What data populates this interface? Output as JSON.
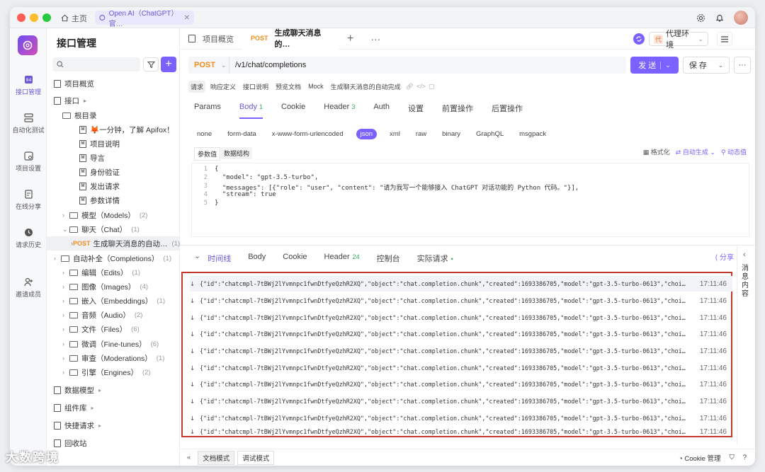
{
  "titlebar": {
    "home_label": "主页",
    "tab_label": "Open AI（ChatGPT）官…"
  },
  "rail": {
    "items": [
      {
        "label": "接口管理"
      },
      {
        "label": "自动化测试"
      },
      {
        "label": "项目设置"
      },
      {
        "label": "在线分享"
      },
      {
        "label": "请求历史"
      },
      {
        "label": "邀请成员"
      }
    ]
  },
  "sidebar": {
    "title": "接口管理",
    "overview": "项目概览",
    "api_root": "接口",
    "root_dir": "根目录",
    "docs": [
      "🦊一分钟，了解 Apifox！",
      "项目说明",
      "导言",
      "身份验证",
      "发出请求",
      "参数详情"
    ],
    "folders": [
      {
        "label": "模型（Models）",
        "count": "(2)"
      },
      {
        "label": "聊天（Chat）",
        "count": "(1)"
      },
      {
        "label": "自动补全（Completions）",
        "count": "(1)"
      },
      {
        "label": "编辑（Edits）",
        "count": "(1)"
      },
      {
        "label": "图像（Images）",
        "count": "(4)"
      },
      {
        "label": "嵌入（Embeddings）",
        "count": "(1)"
      },
      {
        "label": "音频（Audio）",
        "count": "(2)"
      },
      {
        "label": "文件（Files）",
        "count": "(6)"
      },
      {
        "label": "微调（Fine-tunes）",
        "count": "(6)"
      },
      {
        "label": "审查（Moderations）",
        "count": "(1)"
      },
      {
        "label": "引擎（Engines）",
        "count": "(2)"
      }
    ],
    "selected_request": {
      "method": "POST",
      "label": "生成聊天消息的自动…",
      "count": "(1)"
    },
    "bottom": [
      "数据模型",
      "组件库",
      "快捷请求",
      "回收站"
    ]
  },
  "doc_tabs": {
    "overview": "项目概览",
    "active_method": "POST",
    "active_label": "生成聊天消息的…",
    "env_badge": "代",
    "env_label": "代理环境"
  },
  "request": {
    "method": "POST",
    "path": "/v1/chat/completions",
    "send_label": "发 送",
    "save_label": "保 存"
  },
  "subtabs": [
    "请求",
    "响应定义",
    "接口说明",
    "预览文档",
    "Mock",
    "生成聊天消息的自动完成"
  ],
  "param_tabs": [
    {
      "label": "Params",
      "badge": ""
    },
    {
      "label": "Body",
      "badge": "1"
    },
    {
      "label": "Cookie",
      "badge": ""
    },
    {
      "label": "Header",
      "badge": "3"
    },
    {
      "label": "Auth",
      "badge": ""
    },
    {
      "label": "设置",
      "badge": ""
    },
    {
      "label": "前置操作",
      "badge": ""
    },
    {
      "label": "后置操作",
      "badge": ""
    }
  ],
  "body_types": [
    "none",
    "form-data",
    "x-www-form-urlencoded",
    "json",
    "xml",
    "raw",
    "binary",
    "GraphQL",
    "msgpack"
  ],
  "editor": {
    "tab_param": "参数值",
    "tab_struct": "数据结构",
    "format": "格式化",
    "auto_gen": "自动生成",
    "dynamic": "动态值",
    "lines": [
      {
        "n": "1",
        "text": "{"
      },
      {
        "n": "2",
        "text": "  \"model\": \"gpt-3.5-turbo\","
      },
      {
        "n": "3",
        "text": "  \"messages\": [{\"role\": \"user\", \"content\": \"请为我写一个能够接入 ChatGPT 对话功能的 Python 代码。\"}],"
      },
      {
        "n": "4",
        "text": "  \"stream\": true"
      },
      {
        "n": "5",
        "text": "}"
      }
    ]
  },
  "response": {
    "tabs": [
      {
        "label": "时间线",
        "badge": ""
      },
      {
        "label": "Body",
        "badge": ""
      },
      {
        "label": "Cookie",
        "badge": ""
      },
      {
        "label": "Header",
        "badge": "24"
      },
      {
        "label": "控制台",
        "badge": ""
      },
      {
        "label": "实际请求",
        "badge": "•"
      }
    ],
    "share": "分享",
    "side_label": "消息内容",
    "events": [
      {
        "text": "{\"id\":\"chatcmpl-7tBWj2lYvmnpc1fwnDtfyeQzhR2XQ\",\"object\":\"chat.completion.chunk\",\"created\":1693386705,\"model\":\"gpt-3.5-turbo-0613\",\"choi…",
        "time": "17:11:46"
      },
      {
        "text": "{\"id\":\"chatcmpl-7tBWj2lYvmnpc1fwnDtfyeQzhR2XQ\",\"object\":\"chat.completion.chunk\",\"created\":1693386705,\"model\":\"gpt-3.5-turbo-0613\",\"choi…",
        "time": "17:11:46"
      },
      {
        "text": "{\"id\":\"chatcmpl-7tBWj2lYvmnpc1fwnDtfyeQzhR2XQ\",\"object\":\"chat.completion.chunk\",\"created\":1693386705,\"model\":\"gpt-3.5-turbo-0613\",\"choi…",
        "time": "17:11:46"
      },
      {
        "text": "{\"id\":\"chatcmpl-7tBWj2lYvmnpc1fwnDtfyeQzhR2XQ\",\"object\":\"chat.completion.chunk\",\"created\":1693386705,\"model\":\"gpt-3.5-turbo-0613\",\"choi…",
        "time": "17:11:46"
      },
      {
        "text": "{\"id\":\"chatcmpl-7tBWj2lYvmnpc1fwnDtfyeQzhR2XQ\",\"object\":\"chat.completion.chunk\",\"created\":1693386705,\"model\":\"gpt-3.5-turbo-0613\",\"choi…",
        "time": "17:11:46"
      },
      {
        "text": "{\"id\":\"chatcmpl-7tBWj2lYvmnpc1fwnDtfyeQzhR2XQ\",\"object\":\"chat.completion.chunk\",\"created\":1693386705,\"model\":\"gpt-3.5-turbo-0613\",\"choi…",
        "time": "17:11:46"
      },
      {
        "text": "{\"id\":\"chatcmpl-7tBWj2lYvmnpc1fwnDtfyeQzhR2XQ\",\"object\":\"chat.completion.chunk\",\"created\":1693386705,\"model\":\"gpt-3.5-turbo-0613\",\"choi…",
        "time": "17:11:46"
      },
      {
        "text": "{\"id\":\"chatcmpl-7tBWj2lYvmnpc1fwnDtfyeQzhR2XQ\",\"object\":\"chat.completion.chunk\",\"created\":1693386705,\"model\":\"gpt-3.5-turbo-0613\",\"choi…",
        "time": "17:11:46"
      },
      {
        "text": "{\"id\":\"chatcmpl-7tBWj2lYvmnpc1fwnDtfyeQzhR2XQ\",\"object\":\"chat.completion.chunk\",\"created\":1693386705,\"model\":\"gpt-3.5-turbo-0613\",\"choi…",
        "time": "17:11:46"
      },
      {
        "text": "{\"id\":\"chatcmpl-7tBWj2lYvmnpc1fwnDtfyeQzhR2XQ\",\"object\":\"chat.completion.chunk\",\"created\":1693386705,\"model\":\"gpt-3.5-turbo-0613\",\"choi…",
        "time": "17:11:46"
      }
    ]
  },
  "statusbar": {
    "doc_mode": "文档模式",
    "debug_mode": "调试模式",
    "cookie": "Cookie 管理"
  },
  "watermark": "大数跨境",
  "colors": {
    "accent": "#7b61ff",
    "post": "#f08c1b",
    "highlight_border": "#c0392b"
  }
}
